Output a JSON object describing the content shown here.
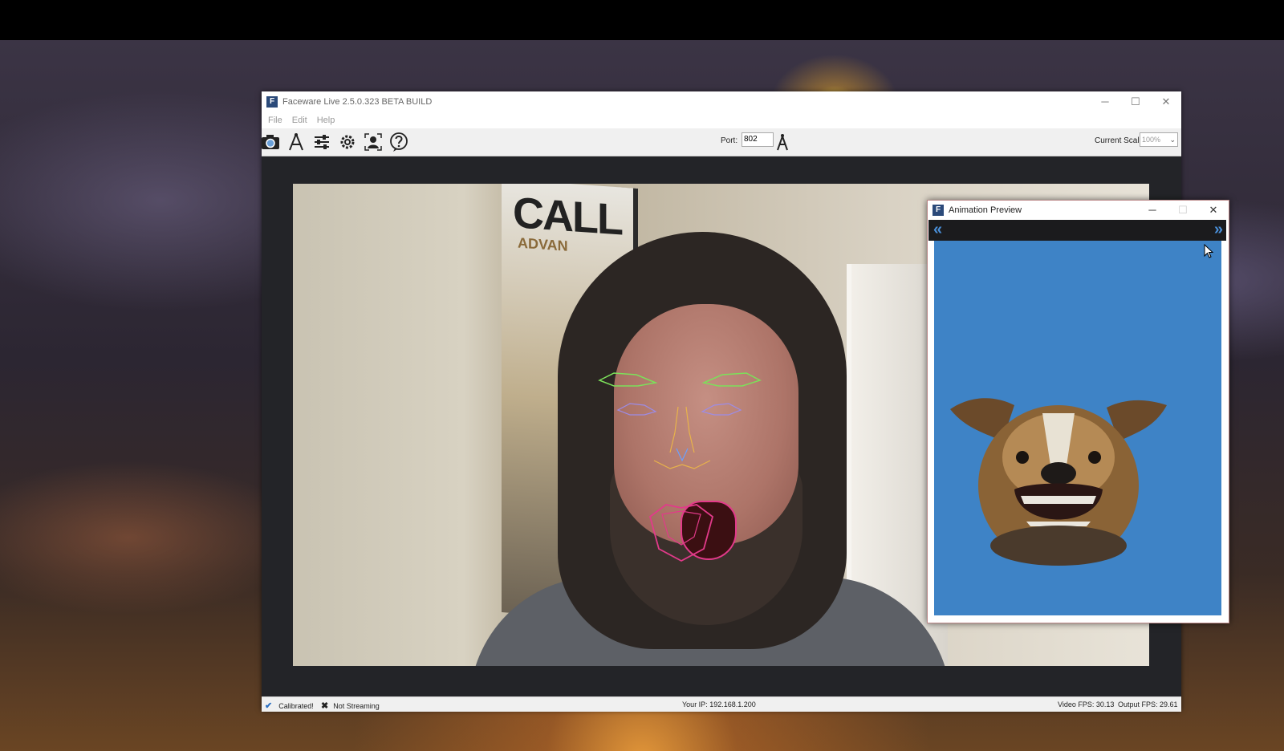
{
  "main_window": {
    "title": "Faceware Live 2.5.0.323 BETA BUILD",
    "controls": {
      "minimize": "─",
      "maximize": "☐",
      "close": "✕"
    }
  },
  "menu": {
    "items": [
      "File",
      "Edit",
      "Help"
    ]
  },
  "toolbar": {
    "icons": [
      "camera-icon",
      "calibrate-icon",
      "settings-sliders-icon",
      "gear-icon",
      "face-tracking-icon",
      "help-icon"
    ],
    "port_label": "Port:",
    "port_value": "802",
    "scale_label": "Current Scale:",
    "scale_value": "100%"
  },
  "video": {
    "poster_text": "CALL",
    "poster_subtext": "ADVAN"
  },
  "status": {
    "calibrated": "Calibrated!",
    "streaming": "Not Streaming",
    "ip": "Your IP: 192.168.1.200",
    "video_fps": "Video FPS: 30.13",
    "output_fps": "Output FPS: 29.61"
  },
  "preview_window": {
    "title": "Animation Preview",
    "controls": {
      "minimize": "─",
      "maximize": "☐",
      "close": "✕"
    },
    "prev_arrow": "«",
    "next_arrow": "»",
    "canvas_color": "#3e83c6"
  }
}
